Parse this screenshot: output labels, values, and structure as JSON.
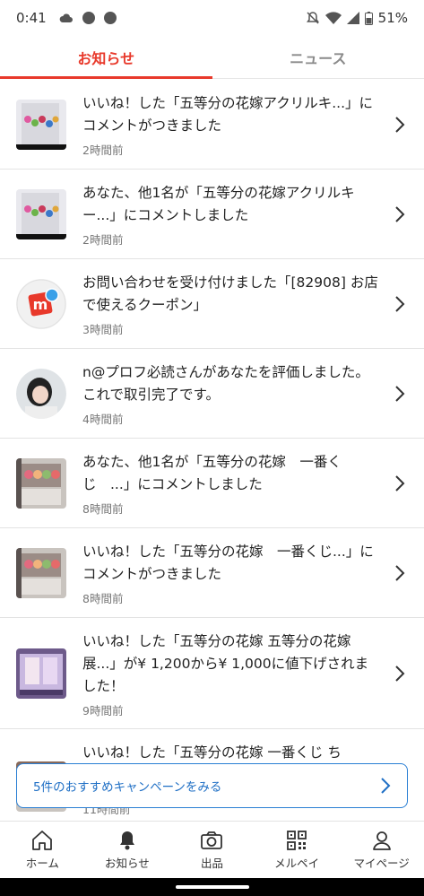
{
  "status_bar": {
    "time": "0:41",
    "battery": "51%"
  },
  "tabs": [
    {
      "label": "お知らせ",
      "active": true
    },
    {
      "label": "ニュース",
      "active": false
    }
  ],
  "notifications": [
    {
      "message": "いいね！した「五等分の花嫁アクリルキ...」にコメントがつきました",
      "time": "2時間前",
      "thumb": "acrylic-keychain-photo"
    },
    {
      "message": "あなた、他1名が「五等分の花嫁アクリルキー...」にコメントしました",
      "time": "2時間前",
      "thumb": "acrylic-keychain-photo"
    },
    {
      "message": "お問い合わせを受け付けました「[82908] お店で使えるクーポン」",
      "time": "3時間前",
      "thumb": "mercari-logo"
    },
    {
      "message": "n@プロフ必読さんがあなたを評価しました。これで取引完了です。",
      "time": "4時間前",
      "thumb": "user-avatar"
    },
    {
      "message": "あなた、他1名が「五等分の花嫁　一番くじ　...」にコメントしました",
      "time": "8時間前",
      "thumb": "figure-photo"
    },
    {
      "message": "いいね！した「五等分の花嫁　一番くじ...」にコメントがつきました",
      "time": "8時間前",
      "thumb": "figure-photo"
    },
    {
      "message": "いいね！した「五等分の花嫁 五等分の花嫁展...」が¥ 1,200から¥ 1,000に値下げされました！",
      "time": "9時間前",
      "thumb": "exhibition-goods-photo"
    },
    {
      "message": "いいね！した「五等分の花嫁 一番くじ ち",
      "time": "11時間前",
      "thumb": "figure-photo"
    }
  ],
  "banner": {
    "label": "5件のおすすめキャンペーンをみる"
  },
  "bottom_nav": [
    {
      "label": "ホーム",
      "icon": "home-icon"
    },
    {
      "label": "お知らせ",
      "icon": "bell-icon"
    },
    {
      "label": "出品",
      "icon": "camera-icon"
    },
    {
      "label": "メルペイ",
      "icon": "qr-code-icon"
    },
    {
      "label": "マイページ",
      "icon": "person-icon"
    }
  ],
  "colors": {
    "accent": "#e8392b",
    "link_blue": "#1f6fc5"
  }
}
